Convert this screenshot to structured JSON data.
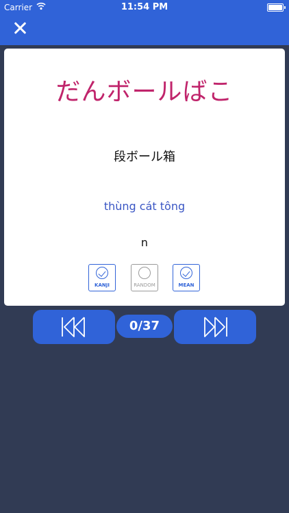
{
  "status_bar": {
    "carrier": "Carrier",
    "time": "11:54 PM"
  },
  "navbar": {
    "close_icon": "close-icon"
  },
  "card": {
    "reading": "だんボールばこ",
    "kanji": "段ボール箱",
    "meaning": "thùng cát tông",
    "word_type": "n"
  },
  "options": [
    {
      "label": "KANJI",
      "checked": true
    },
    {
      "label": "RANDOM",
      "checked": false
    },
    {
      "label": "MEAN",
      "checked": true
    }
  ],
  "pager": {
    "counter": "0/37"
  },
  "colors": {
    "accent": "#3063d8",
    "background": "#313b54",
    "reading_text": "#c0246b",
    "meaning_text": "#3a56c4"
  }
}
